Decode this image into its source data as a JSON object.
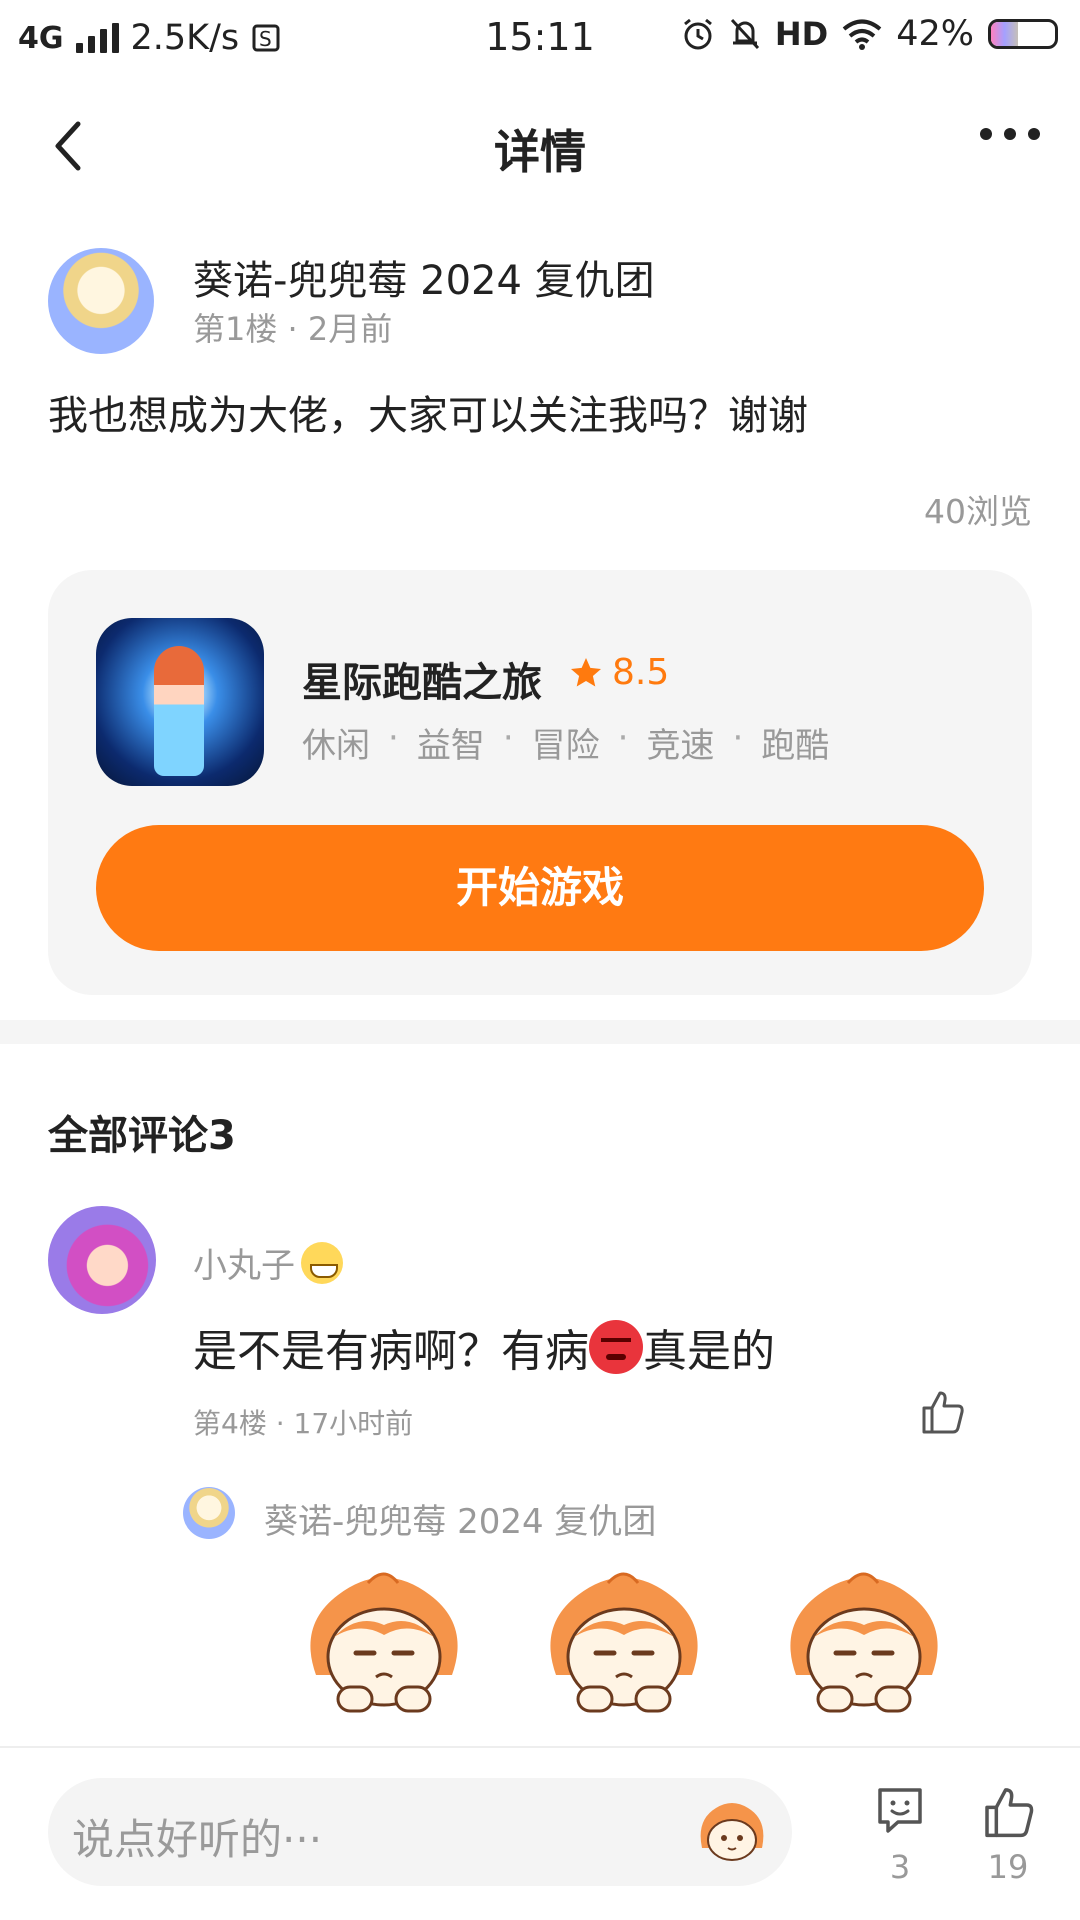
{
  "status_bar": {
    "network": "4G",
    "speed": "2.5K/s",
    "time": "15:11",
    "hd": "HD",
    "battery": "42%",
    "battery_level": 0.42
  },
  "header": {
    "title": "详情",
    "back_icon": "chevron-left-icon",
    "more_icon": "more-dots-icon"
  },
  "post": {
    "username": "葵诺-兜兜莓 2024 复仇团",
    "meta": "第1楼 · 2月前",
    "content": "我也想成为大佬，大家可以关注我吗？谢谢",
    "views": "40浏览"
  },
  "game": {
    "name": "星际跑酷之旅",
    "rating": "8.5",
    "tags": [
      "休闲",
      "益智",
      "冒险",
      "竞速",
      "跑酷"
    ],
    "button": "开始游戏",
    "accent": "#ff7a12"
  },
  "comments": {
    "title": "全部评论3",
    "items": [
      {
        "username": "小丸子",
        "content_before": "是不是有病啊？有病",
        "content_after": "真是的",
        "meta": "第4楼 · 17小时前",
        "reply": {
          "username": "葵诺-兜兜莓 2024 复仇团"
        }
      }
    ]
  },
  "bottom_bar": {
    "input_placeholder": "说点好听的···",
    "comment_count": "3",
    "like_count": "19"
  }
}
